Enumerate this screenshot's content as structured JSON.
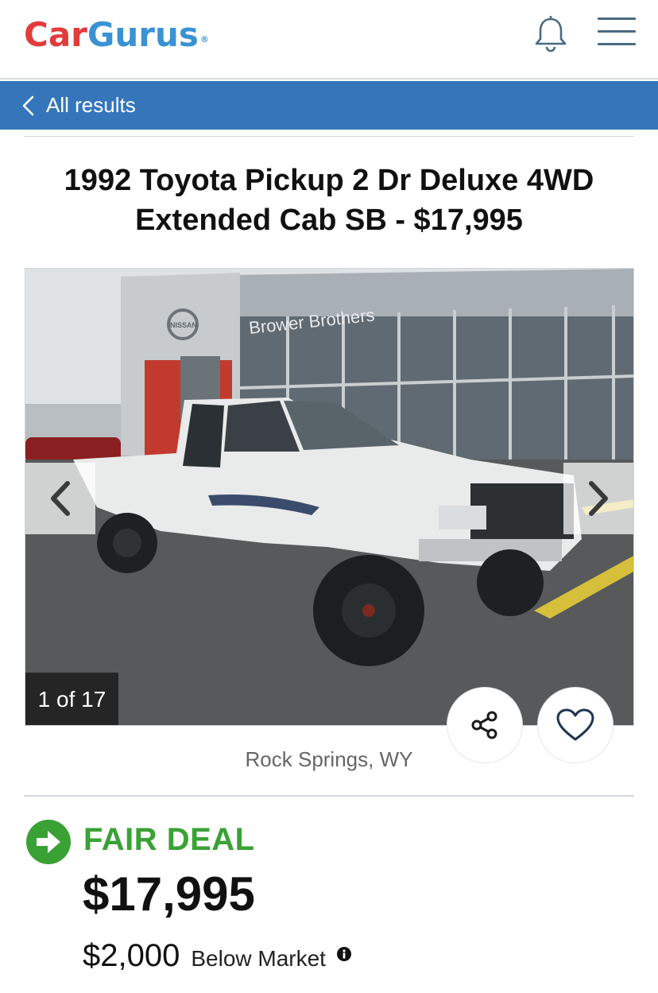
{
  "header": {
    "logo_left": "Car",
    "logo_right": "Gurus",
    "logo_mark": "®",
    "notifications_icon": "bell-icon",
    "menu_icon": "hamburger-menu-icon"
  },
  "nav": {
    "back_label": "All results",
    "back_icon": "chevron-left-icon"
  },
  "listing": {
    "title": "1992 Toyota Pickup 2 Dr Deluxe 4WD Extended Cab SB - $17,995",
    "photo_counter": "1 of 17",
    "location": "Rock Springs, WY"
  },
  "photo_scene": {
    "dealer_sign": "Brower Brothers",
    "brand_badge": "NISSAN"
  },
  "actions": {
    "share_icon": "share-icon",
    "favorite_icon": "heart-icon"
  },
  "deal": {
    "rating": "FAIR DEAL",
    "rating_icon": "arrow-right-circle-icon",
    "price": "$17,995",
    "difference": "$2,000",
    "difference_label": "Below Market",
    "info_icon": "info-icon"
  },
  "colors": {
    "brand_red": "#e23b3b",
    "brand_blue": "#3a92d4",
    "nav_bar": "#3576bb",
    "deal_green": "#3aa135"
  }
}
